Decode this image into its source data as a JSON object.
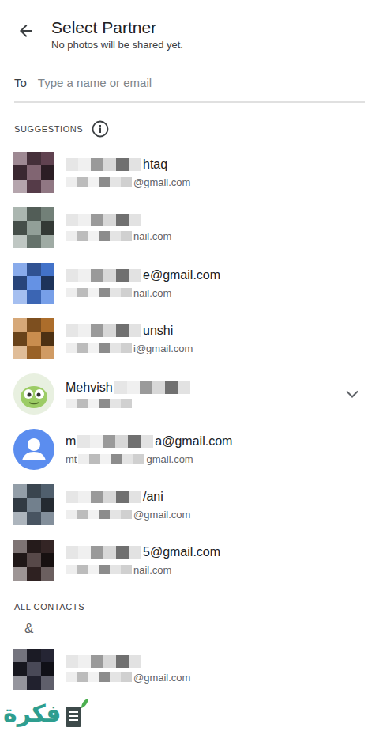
{
  "header": {
    "title": "Select Partner",
    "subtitle": "No photos will be shared yet."
  },
  "to_field": {
    "label": "To",
    "placeholder": "Type a name or email"
  },
  "suggestions": {
    "label": "SUGGESTIONS",
    "contacts": [
      {
        "kind": "photo",
        "color": "#6b4a5a",
        "nameLead": "",
        "nameTail": "htaq",
        "emailLead": "",
        "emailTail": "@gmail.com",
        "expandable": false
      },
      {
        "kind": "photo",
        "color": "#7f8f86",
        "nameLead": "",
        "nameTail": "",
        "emailLead": "",
        "emailTail": "nail.com",
        "expandable": false
      },
      {
        "kind": "photo",
        "color": "#4a7fe0",
        "nameLead": "",
        "nameTail": "e@gmail.com",
        "emailLead": "",
        "emailTail": "nail.com",
        "expandable": false
      },
      {
        "kind": "photo",
        "color": "#c07a30",
        "nameLead": "",
        "nameTail": "unshi",
        "emailLead": "",
        "emailTail": "i@gmail.com",
        "expandable": false
      },
      {
        "kind": "cartoon",
        "color": "#b8d8a0",
        "nameLead": "Mehvish",
        "nameTail": "",
        "emailLead": "",
        "emailTail": "",
        "expandable": true
      },
      {
        "kind": "default",
        "color": "#5b8def",
        "nameLead": "m",
        "nameTail": "a@gmail.com",
        "emailLead": "mt",
        "emailTail": "gmail.com",
        "expandable": false
      },
      {
        "kind": "photo",
        "color": "#5a6a7a",
        "nameLead": "",
        "nameTail": "/ani",
        "emailLead": "",
        "emailTail": "@gmail.com",
        "expandable": false
      },
      {
        "kind": "photo",
        "color": "#3a2a2a",
        "nameLead": "",
        "nameTail": "5@gmail.com",
        "emailLead": "",
        "emailTail": "nail.com",
        "expandable": false
      }
    ]
  },
  "all_contacts": {
    "label": "ALL CONTACTS",
    "group": "&",
    "contacts": [
      {
        "kind": "photo",
        "color": "#2a2a3a",
        "nameLead": "",
        "nameTail": "",
        "emailLead": "",
        "emailTail": "@gmail.com",
        "expandable": false
      }
    ]
  },
  "watermark": {
    "text": "فكرة"
  }
}
